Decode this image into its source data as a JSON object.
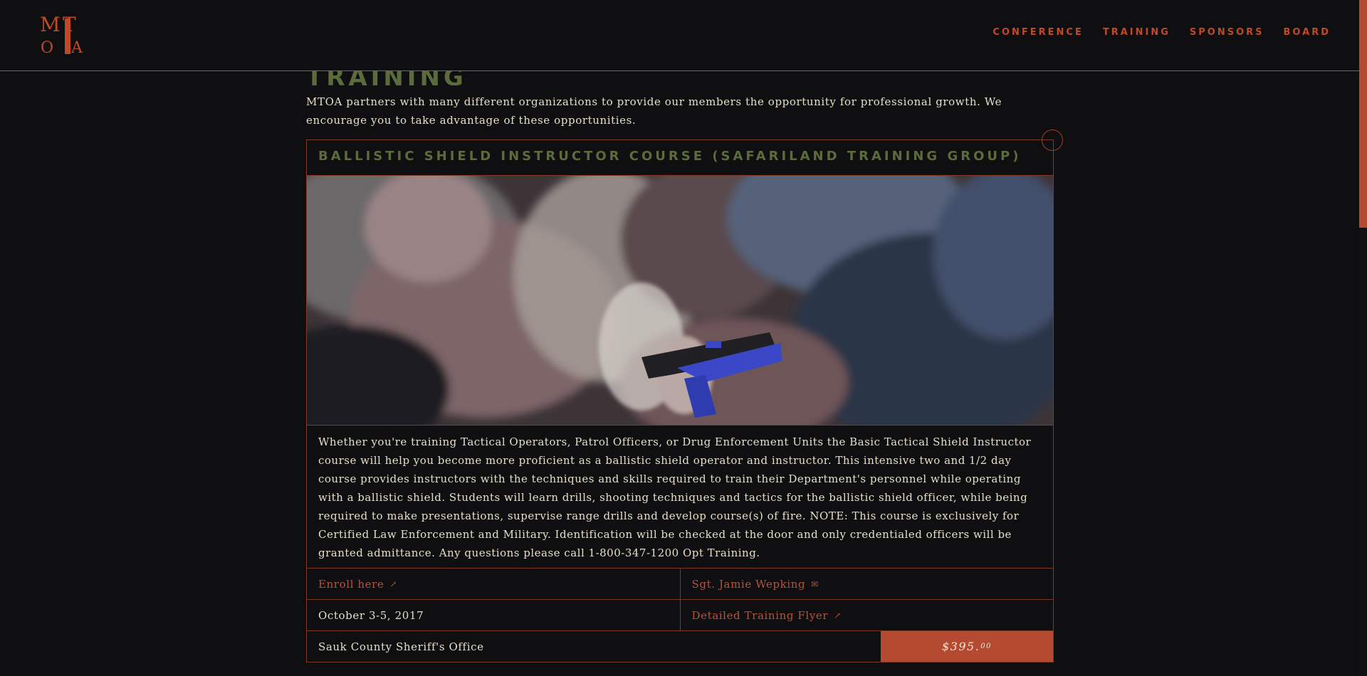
{
  "brand": {
    "logo_letters": [
      "M",
      "T",
      "O",
      "A"
    ],
    "accent_color": "#c0492a",
    "heading_color": "#5b6b3c"
  },
  "nav": {
    "items": [
      {
        "label": "CONFERENCE"
      },
      {
        "label": "TRAINING"
      },
      {
        "label": "SPONSORS"
      },
      {
        "label": "BOARD"
      }
    ]
  },
  "page": {
    "title": "TRAINING",
    "intro": "MTOA partners with many different organizations to provide our members the opportunity for professional growth. We encourage you to take advantage of these opportunities."
  },
  "course": {
    "title": "BALLISTIC SHIELD INSTRUCTOR COURSE (SAFARILAND TRAINING GROUP)",
    "image_icon": "training-photo",
    "description": "Whether you're training Tactical Operators, Patrol Officers, or Drug Enforcement Units the Basic Tactical Shield Instructor course will help you become more proficient as a ballistic shield operator and instructor. This intensive two and 1/2 day course provides instructors with the techniques and skills required to train their Department's personnel while operating with a ballistic shield. Students will learn drills, shooting techniques and tactics for the ballistic shield officer, while being required to make presentations, supervise range drills and develop course(s) of fire. NOTE: This course is exclusively for Certified Law Enforcement and Military. Identification will be checked at the door and only credentialed officers will be granted admittance. Any questions please call 1-800-347-1200 Opt Training.",
    "enroll_label": "Enroll here",
    "contact_label": "Sgt. Jamie Wepking",
    "date": "October 3-5, 2017",
    "flyer_label": "Detailed Training Flyer",
    "location": "Sauk County Sheriff's Office",
    "price_main": "$395.",
    "price_cents": "00"
  }
}
